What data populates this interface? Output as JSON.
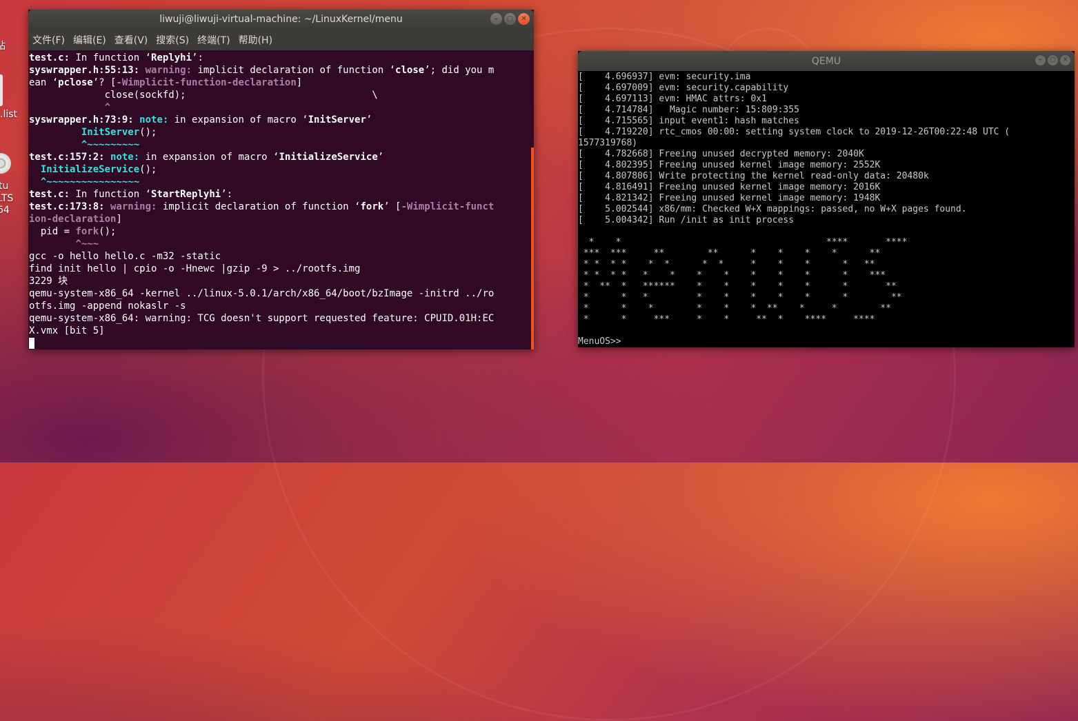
{
  "desktop": {
    "labels": [
      "站",
      ".list",
      "tu",
      "LTS",
      "64"
    ]
  },
  "terminal": {
    "title": "liwuji@liwuji-virtual-machine: ~/LinuxKernel/menu",
    "menu": [
      "文件(F)",
      "编辑(E)",
      "查看(V)",
      "搜索(S)",
      "终端(T)",
      "帮助(H)"
    ],
    "window_buttons": [
      "–",
      "▢",
      "✕"
    ],
    "lines": [
      [
        {
          "t": "test.c:",
          "c": "b"
        },
        {
          "t": " In function ‘"
        },
        {
          "t": "Replyhi",
          "c": "b"
        },
        {
          "t": "’:"
        }
      ],
      [
        {
          "t": "syswrapper.h:55:13:",
          "c": "b"
        },
        {
          "t": " "
        },
        {
          "t": "warning:",
          "c": "mag"
        },
        {
          "t": " implicit declaration of function ‘"
        },
        {
          "t": "close",
          "c": "b"
        },
        {
          "t": "’; did you m"
        }
      ],
      [
        {
          "t": "ean ‘"
        },
        {
          "t": "pclose",
          "c": "b"
        },
        {
          "t": "’? ["
        },
        {
          "t": "-Wimplicit-function-declaration",
          "c": "mag"
        },
        {
          "t": "]"
        }
      ],
      [
        {
          "t": "             close(sockfd);                                \\"
        }
      ],
      [
        {
          "t": "             "
        },
        {
          "t": "^",
          "c": "mag"
        }
      ],
      [
        {
          "t": "syswrapper.h:73:9:",
          "c": "b"
        },
        {
          "t": " "
        },
        {
          "t": "note:",
          "c": "cyan"
        },
        {
          "t": " in expansion of macro ‘"
        },
        {
          "t": "InitServer",
          "c": "b"
        },
        {
          "t": "’"
        }
      ],
      [
        {
          "t": "         "
        },
        {
          "t": "InitServer",
          "c": "cyan"
        },
        {
          "t": "();"
        }
      ],
      [
        {
          "t": "         "
        },
        {
          "t": "^~~~~~~~~~",
          "c": "cyan"
        }
      ],
      [
        {
          "t": "test.c:157:2:",
          "c": "b"
        },
        {
          "t": " "
        },
        {
          "t": "note:",
          "c": "cyan"
        },
        {
          "t": " in expansion of macro ‘"
        },
        {
          "t": "InitializeService",
          "c": "b"
        },
        {
          "t": "’"
        }
      ],
      [
        {
          "t": "  "
        },
        {
          "t": "InitializeService",
          "c": "cyan"
        },
        {
          "t": "();"
        }
      ],
      [
        {
          "t": "  "
        },
        {
          "t": "^~~~~~~~~~~~~~~~~",
          "c": "cyan"
        }
      ],
      [
        {
          "t": "test.c:",
          "c": "b"
        },
        {
          "t": " In function ‘"
        },
        {
          "t": "StartReplyhi",
          "c": "b"
        },
        {
          "t": "’:"
        }
      ],
      [
        {
          "t": "test.c:173:8:",
          "c": "b"
        },
        {
          "t": " "
        },
        {
          "t": "warning:",
          "c": "mag"
        },
        {
          "t": " implicit declaration of function ‘"
        },
        {
          "t": "fork",
          "c": "b"
        },
        {
          "t": "’ ["
        },
        {
          "t": "-Wimplicit-funct",
          "c": "mag"
        }
      ],
      [
        {
          "t": "ion-declaration",
          "c": "mag"
        },
        {
          "t": "]"
        }
      ],
      [
        {
          "t": "  pid = "
        },
        {
          "t": "fork",
          "c": "mag"
        },
        {
          "t": "();"
        }
      ],
      [
        {
          "t": "        "
        },
        {
          "t": "^~~~",
          "c": "mag"
        }
      ],
      [
        {
          "t": "gcc -o hello hello.c -m32 -static"
        }
      ],
      [
        {
          "t": "find init hello | cpio -o -Hnewc |gzip -9 > ../rootfs.img"
        }
      ],
      [
        {
          "t": "3229 块"
        }
      ],
      [
        {
          "t": "qemu-system-x86_64 -kernel ../linux-5.0.1/arch/x86_64/boot/bzImage -initrd ../ro"
        }
      ],
      [
        {
          "t": "otfs.img -append nokaslr -s"
        }
      ],
      [
        {
          "t": "qemu-system-x86_64: warning: TCG doesn't support requested feature: CPUID.01H:EC"
        }
      ],
      [
        {
          "t": "X.vmx [bit 5]"
        }
      ]
    ]
  },
  "qemu": {
    "title": "QEMU",
    "window_buttons": [
      "–",
      "▢",
      "✕"
    ],
    "lines": [
      "[    4.696937] evm: security.ima",
      "[    4.697009] evm: security.capability",
      "[    4.697113] evm: HMAC attrs: 0x1",
      "[    4.714784]   Magic number: 15:809:355",
      "[    4.715565] input event1: hash matches",
      "[    4.719220] rtc_cmos 00:00: setting system clock to 2019-12-26T00:22:48 UTC (",
      "1577319768)",
      "[    4.782668] Freeing unused decrypted memory: 2040K",
      "[    4.802395] Freeing unused kernel image memory: 2552K",
      "[    4.807806] Write protecting the kernel read-only data: 20480k",
      "[    4.816491] Freeing unused kernel image memory: 2016K",
      "[    4.821342] Freeing unused kernel image memory: 1948K",
      "[    5.002544] x86/mm: Checked W+X mappings: passed, no W+X pages found.",
      "[    5.004342] Run /init as init process",
      "",
      "  *    *                                      ****       ****",
      " ***  ***     **        **      *    *    *    *      **",
      " * *  * *    *  *      *  *     *    *    *      *   **",
      " * *  * *   *    *    *    *    *    *    *      *    ***",
      " *  **  *   ******    *    *    *    *    *      *       **",
      " *      *   *         *    *    *    *    *      *        **",
      " *      *    *        *    *    *  **    *     *        **",
      " *      *     ***     *    *     **  *    ****     ****",
      "",
      "MenuOS>>"
    ]
  }
}
